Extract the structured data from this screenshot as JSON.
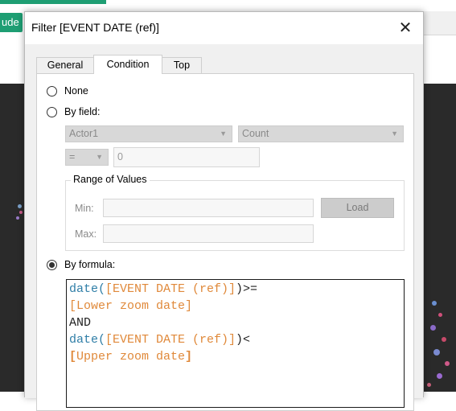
{
  "background": {
    "button_label": "ude"
  },
  "dialog": {
    "title": "Filter [EVENT DATE (ref)]",
    "close_icon": "close-icon",
    "tabs": [
      {
        "label": "General",
        "active": false
      },
      {
        "label": "Condition",
        "active": true
      },
      {
        "label": "Top",
        "active": false
      }
    ],
    "condition": {
      "none_label": "None",
      "by_field_label": "By field:",
      "field_select": "Actor1",
      "aggregation_select": "Count",
      "operator_select": "=",
      "value_input": "0",
      "range": {
        "label": "Range of Values",
        "min_label": "Min:",
        "max_label": "Max:",
        "min_value": "",
        "max_value": "",
        "load_label": "Load"
      },
      "by_formula_label": "By formula:",
      "selected": "By formula",
      "formula": {
        "line1_fn": "date(",
        "line1_field": "[EVENT DATE (ref)]",
        "line1_rest": ")>=",
        "line2_field": "[Lower zoom date]",
        "line3": "AND",
        "line4_fn": "date(",
        "line4_field": "[EVENT DATE (ref)]",
        "line4_rest": ")<",
        "line5_open": "[",
        "line5_field": "Upper zoom date",
        "line5_close": "]"
      }
    }
  },
  "colors": {
    "function": "#2f7ea7",
    "field": "#e0893a",
    "accent_green": "#1e9e73"
  }
}
